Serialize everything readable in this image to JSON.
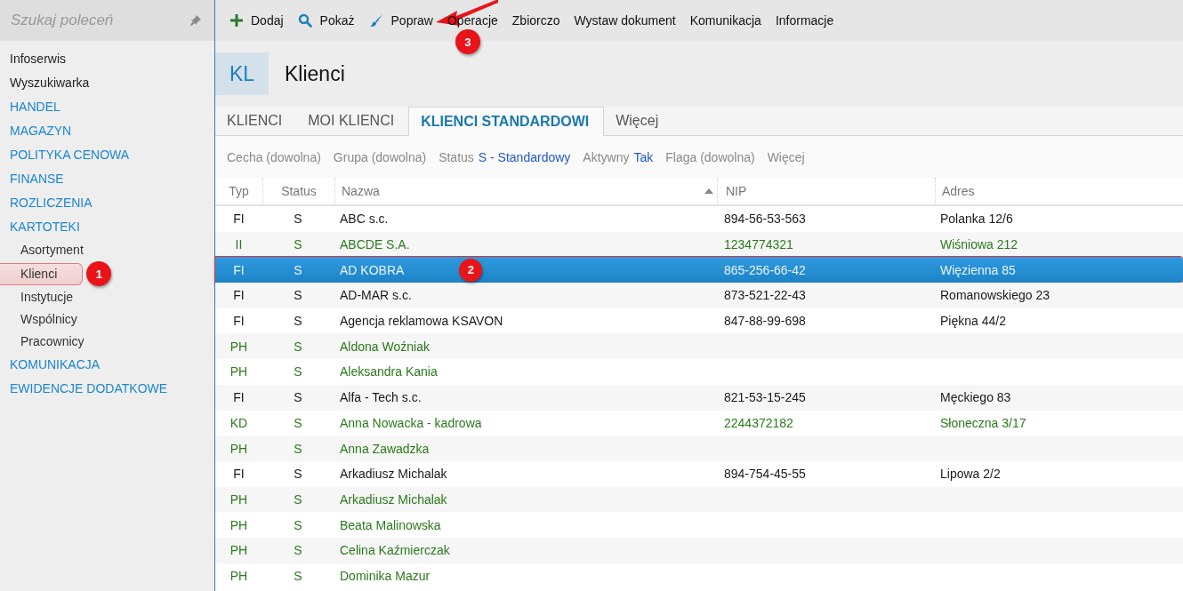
{
  "sidebar": {
    "search": {
      "placeholder": "Szukaj poleceń"
    },
    "items": [
      {
        "label": "Infoserwis",
        "kind": "item",
        "selected": false
      },
      {
        "label": "Wyszukiwarka",
        "kind": "item",
        "selected": false
      },
      {
        "label": "HANDEL",
        "kind": "group",
        "selected": false
      },
      {
        "label": "MAGAZYN",
        "kind": "group",
        "selected": false
      },
      {
        "label": "POLITYKA CENOWA",
        "kind": "group",
        "selected": false
      },
      {
        "label": "FINANSE",
        "kind": "group",
        "selected": false
      },
      {
        "label": "ROZLICZENIA",
        "kind": "group",
        "selected": false
      },
      {
        "label": "KARTOTEKI",
        "kind": "group",
        "selected": false,
        "expanded": true,
        "children": [
          {
            "label": "Asortyment",
            "selected": false
          },
          {
            "label": "Klienci",
            "selected": true,
            "callout": "1"
          },
          {
            "label": "Instytucje",
            "selected": false
          },
          {
            "label": "Wspólnicy",
            "selected": false
          },
          {
            "label": "Pracownicy",
            "selected": false
          }
        ]
      },
      {
        "label": "KOMUNIKACJA",
        "kind": "group",
        "selected": false
      },
      {
        "label": "EWIDENCJE DODATKOWE",
        "kind": "group",
        "selected": false
      }
    ]
  },
  "toolbar": [
    {
      "label": "Dodaj"
    },
    {
      "label": "Pokaż"
    },
    {
      "label": "Popraw",
      "callout": "3"
    },
    {
      "label": "Operacje"
    },
    {
      "label": "Zbiorczo"
    },
    {
      "label": "Wystaw dokument"
    },
    {
      "label": "Komunikacja"
    },
    {
      "label": "Informacje"
    }
  ],
  "header": {
    "badge": "KL",
    "title": "Klienci"
  },
  "tabs": [
    {
      "label": "KLIENCI",
      "selected": false
    },
    {
      "label": "MOI KLIENCI",
      "selected": false
    },
    {
      "label": "KLIENCI STANDARDOWI",
      "selected": true
    },
    {
      "label": "Więcej",
      "selected": false
    }
  ],
  "filters": [
    {
      "label": "Cecha (dowolna)"
    },
    {
      "label": "Grupa (dowolna)"
    },
    {
      "label": "Status",
      "value": "S - Standardowy"
    },
    {
      "label": "Aktywny",
      "value": "Tak"
    },
    {
      "label": "Flaga (dowolna)"
    },
    {
      "label": "Więcej"
    }
  ],
  "table": {
    "columns": [
      {
        "label": "Typ"
      },
      {
        "label": "Status"
      },
      {
        "label": "Nazwa",
        "sort_ascending": true
      },
      {
        "label": "NIP"
      },
      {
        "label": "Adres"
      }
    ],
    "rows": [
      {
        "cells": [
          "FI",
          "S",
          "ABC s.c.",
          "894-56-53-563",
          "Polanka  12/6"
        ],
        "color": "#1a1a1a",
        "selected": false
      },
      {
        "cells": [
          "II",
          "S",
          "ABCDE S.A.",
          "1234774321",
          "Wiśniowa 212"
        ],
        "color": "#2a7a1a",
        "selected": false
      },
      {
        "cells": [
          "FI",
          "S",
          "AD KOBRA",
          "865-256-66-42",
          "Więzienna  85"
        ],
        "selected": true,
        "callout": "2"
      },
      {
        "cells": [
          "FI",
          "S",
          "AD-MAR s.c.",
          "873-521-22-43",
          "Romanowskiego 23"
        ],
        "color": "#1a1a1a",
        "selected": false
      },
      {
        "cells": [
          "FI",
          "S",
          "Agencja reklamowa KSAVON",
          "847-88-99-698",
          "Piękna  44/2"
        ],
        "color": "#1a1a1a",
        "selected": false
      },
      {
        "cells": [
          "PH",
          "S",
          "Aldona Woźniak",
          "",
          ""
        ],
        "color": "#2a7a1a",
        "selected": false
      },
      {
        "cells": [
          "PH",
          "S",
          "Aleksandra Kania",
          "",
          ""
        ],
        "color": "#2a7a1a",
        "selected": false
      },
      {
        "cells": [
          "FI",
          "S",
          "Alfa - Tech s.c.",
          "821-53-15-245",
          "Męckiego  83"
        ],
        "color": "#1a1a1a",
        "selected": false
      },
      {
        "cells": [
          "KD",
          "S",
          "Anna Nowacka - kadrowa",
          "2244372182",
          "Słoneczna 3/17"
        ],
        "color": "#2a7a1a",
        "selected": false
      },
      {
        "cells": [
          "PH",
          "S",
          "Anna Zawadzka",
          "",
          ""
        ],
        "color": "#2a7a1a",
        "selected": false
      },
      {
        "cells": [
          "FI",
          "S",
          "Arkadiusz Michalak",
          "894-754-45-55",
          "Lipowa  2/2"
        ],
        "color": "#1a1a1a",
        "selected": false
      },
      {
        "cells": [
          "PH",
          "S",
          "Arkadiusz Michalak",
          "",
          ""
        ],
        "color": "#2a7a1a",
        "selected": false
      },
      {
        "cells": [
          "PH",
          "S",
          "Beata Malinowska",
          "",
          ""
        ],
        "color": "#2a7a1a",
        "selected": false
      },
      {
        "cells": [
          "PH",
          "S",
          "Celina Kaźmierczak",
          "",
          ""
        ],
        "color": "#2a7a1a",
        "selected": false
      },
      {
        "cells": [
          "PH",
          "S",
          "Dominika Mazur",
          "",
          ""
        ],
        "color": "#2a7a1a",
        "selected": false
      }
    ]
  }
}
